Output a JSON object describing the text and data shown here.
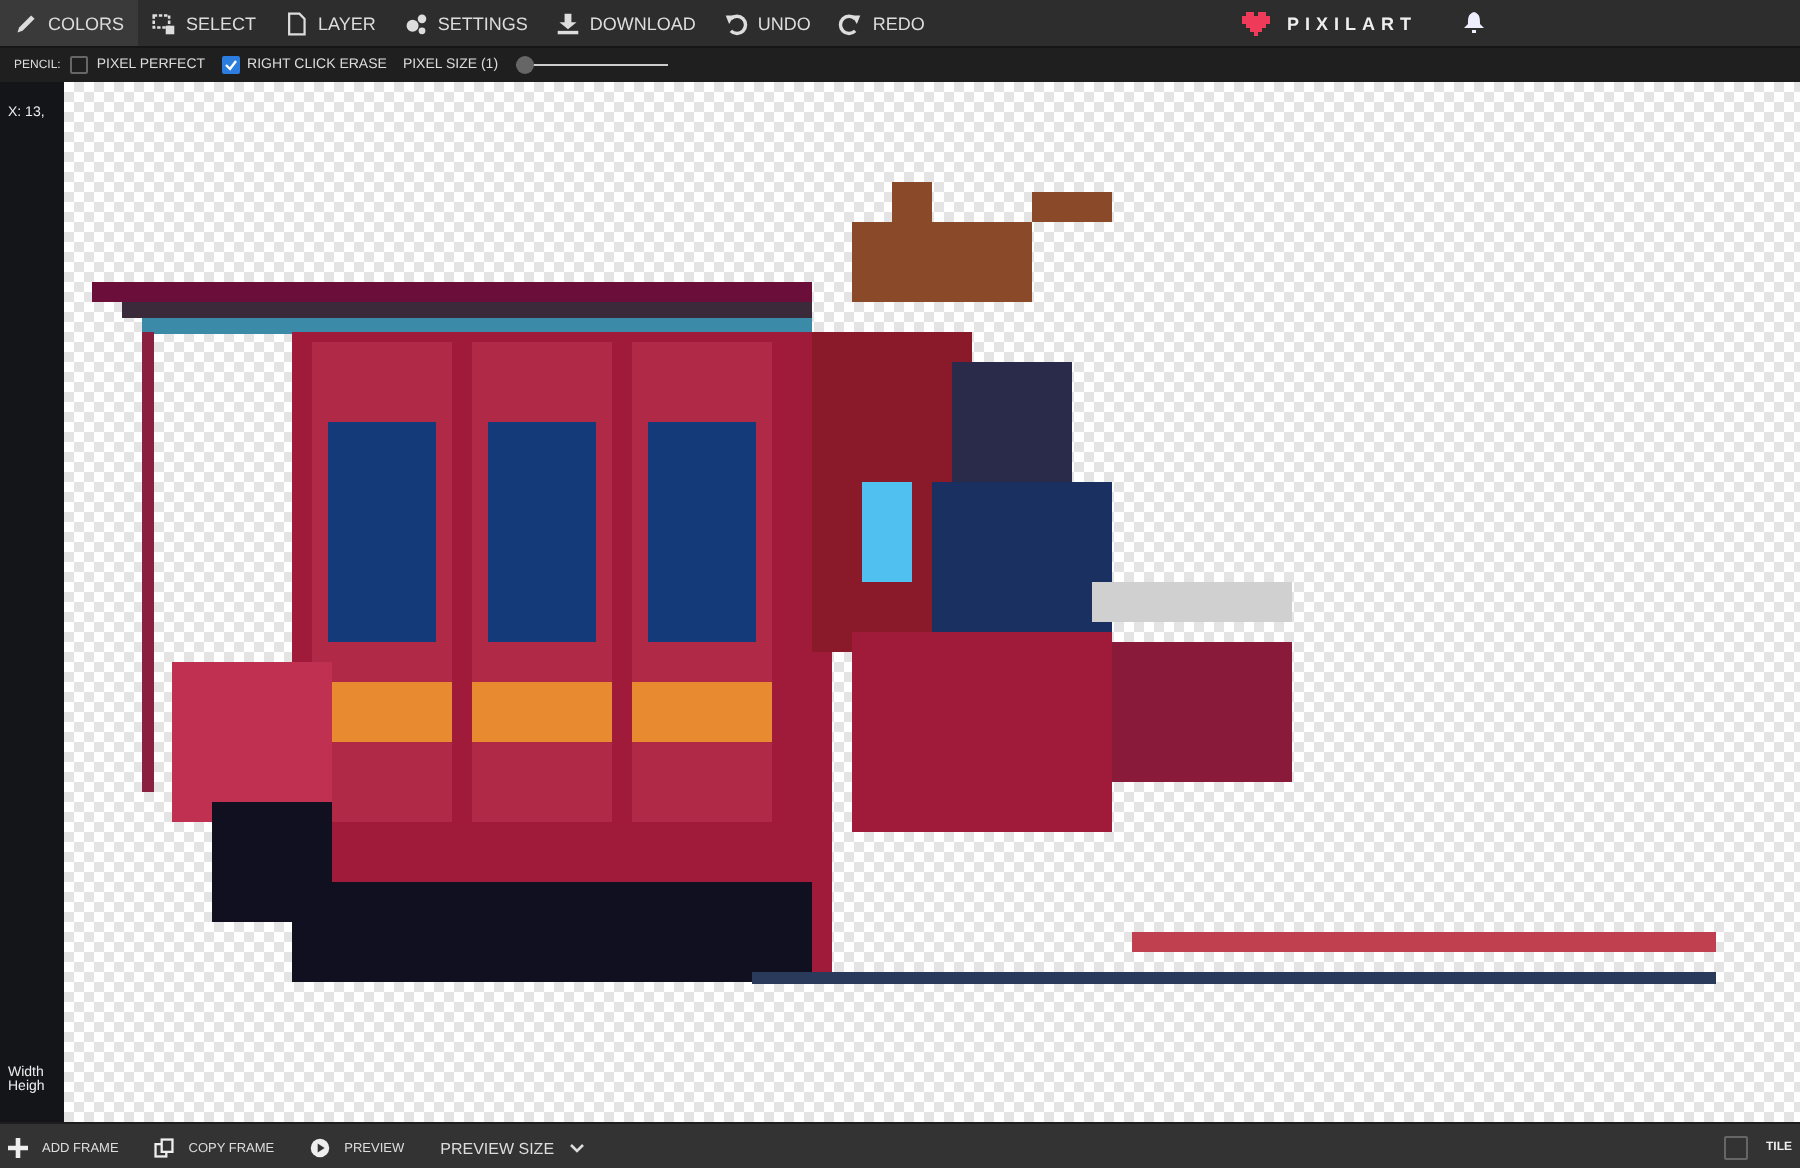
{
  "menu": [
    {
      "label": "COLORS",
      "selected": true
    },
    {
      "label": "SELECT",
      "selected": false
    },
    {
      "label": "LAYER",
      "selected": false
    },
    {
      "label": "SETTINGS",
      "selected": false
    },
    {
      "label": "DOWNLOAD",
      "selected": false
    },
    {
      "label": "UNDO",
      "selected": false
    },
    {
      "label": "REDO",
      "selected": false
    }
  ],
  "logo": {
    "text": "PIXILART"
  },
  "pencil_options": {
    "label": "PENCIL:",
    "options": [
      {
        "label": "PIXEL PERFECT",
        "checked": false
      },
      {
        "label": "RIGHT CLICK ERASE",
        "checked": true
      }
    ],
    "pixel_size": {
      "label": "PIXEL SIZE (1)",
      "level": 0
    }
  },
  "side_panel": {
    "cursor": "X: 13,",
    "width_label": "Width",
    "height_label": "Heigh"
  },
  "bottom_bar": {
    "buttons": [
      {
        "label": "ADD FRAME",
        "kind": "add"
      },
      {
        "label": "COPY FRAME",
        "kind": "copy"
      },
      {
        "label": "PREVIEW",
        "kind": "play"
      }
    ],
    "preview_size": "PREVIEW SIZE",
    "tile": {
      "label": "TILE",
      "checked": false
    }
  }
}
